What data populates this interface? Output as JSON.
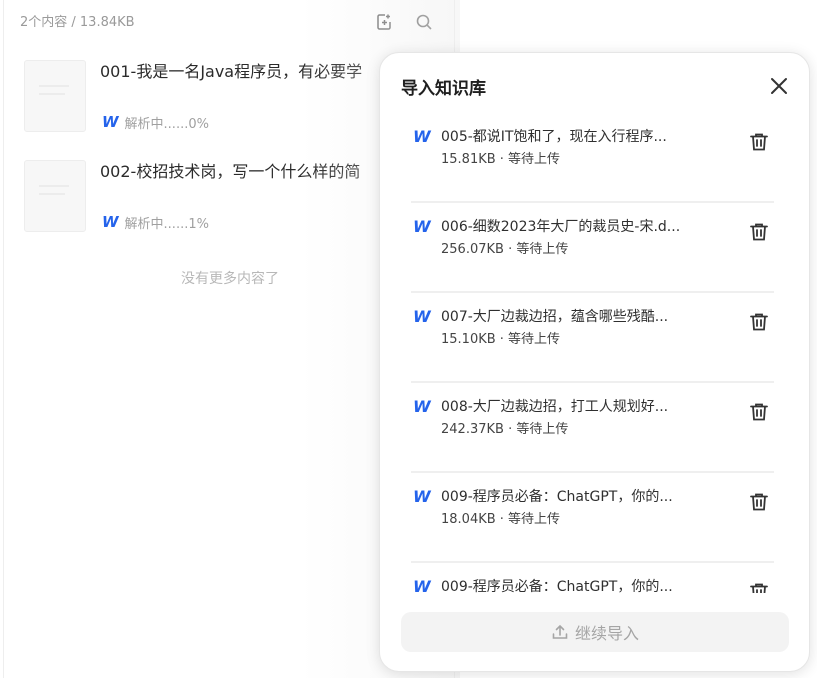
{
  "left": {
    "summary": "2个内容 / 13.84KB",
    "icons": [
      "add-file-icon",
      "search-icon"
    ],
    "files": [
      {
        "title": "001-我是一名Java程序员，有必要学",
        "status": "解析中......0%"
      },
      {
        "title": "002-校招技术岗，写一个什么样的简",
        "status": "解析中......1%"
      }
    ],
    "no_more": "没有更多内容了"
  },
  "panel": {
    "title": "导入知识库",
    "items": [
      {
        "name": "005-都说IT饱和了，现在入行程序...",
        "meta": "15.81KB · 等待上传"
      },
      {
        "name": "006-细数2023年大厂的裁员史-宋.d...",
        "meta": "256.07KB · 等待上传"
      },
      {
        "name": "007-大厂边裁边招，蕴含哪些残酷...",
        "meta": "15.10KB · 等待上传"
      },
      {
        "name": "008-大厂边裁边招，打工人规划好...",
        "meta": "242.37KB · 等待上传"
      },
      {
        "name": "009-程序员必备：ChatGPT，你的...",
        "meta": "18.04KB · 等待上传"
      },
      {
        "name": "009-程序员必备：ChatGPT，你的...",
        "meta": ""
      }
    ],
    "continue_label": "继续导入"
  },
  "colors": {
    "accent": "#2463eb",
    "muted": "#a5a5a5"
  }
}
